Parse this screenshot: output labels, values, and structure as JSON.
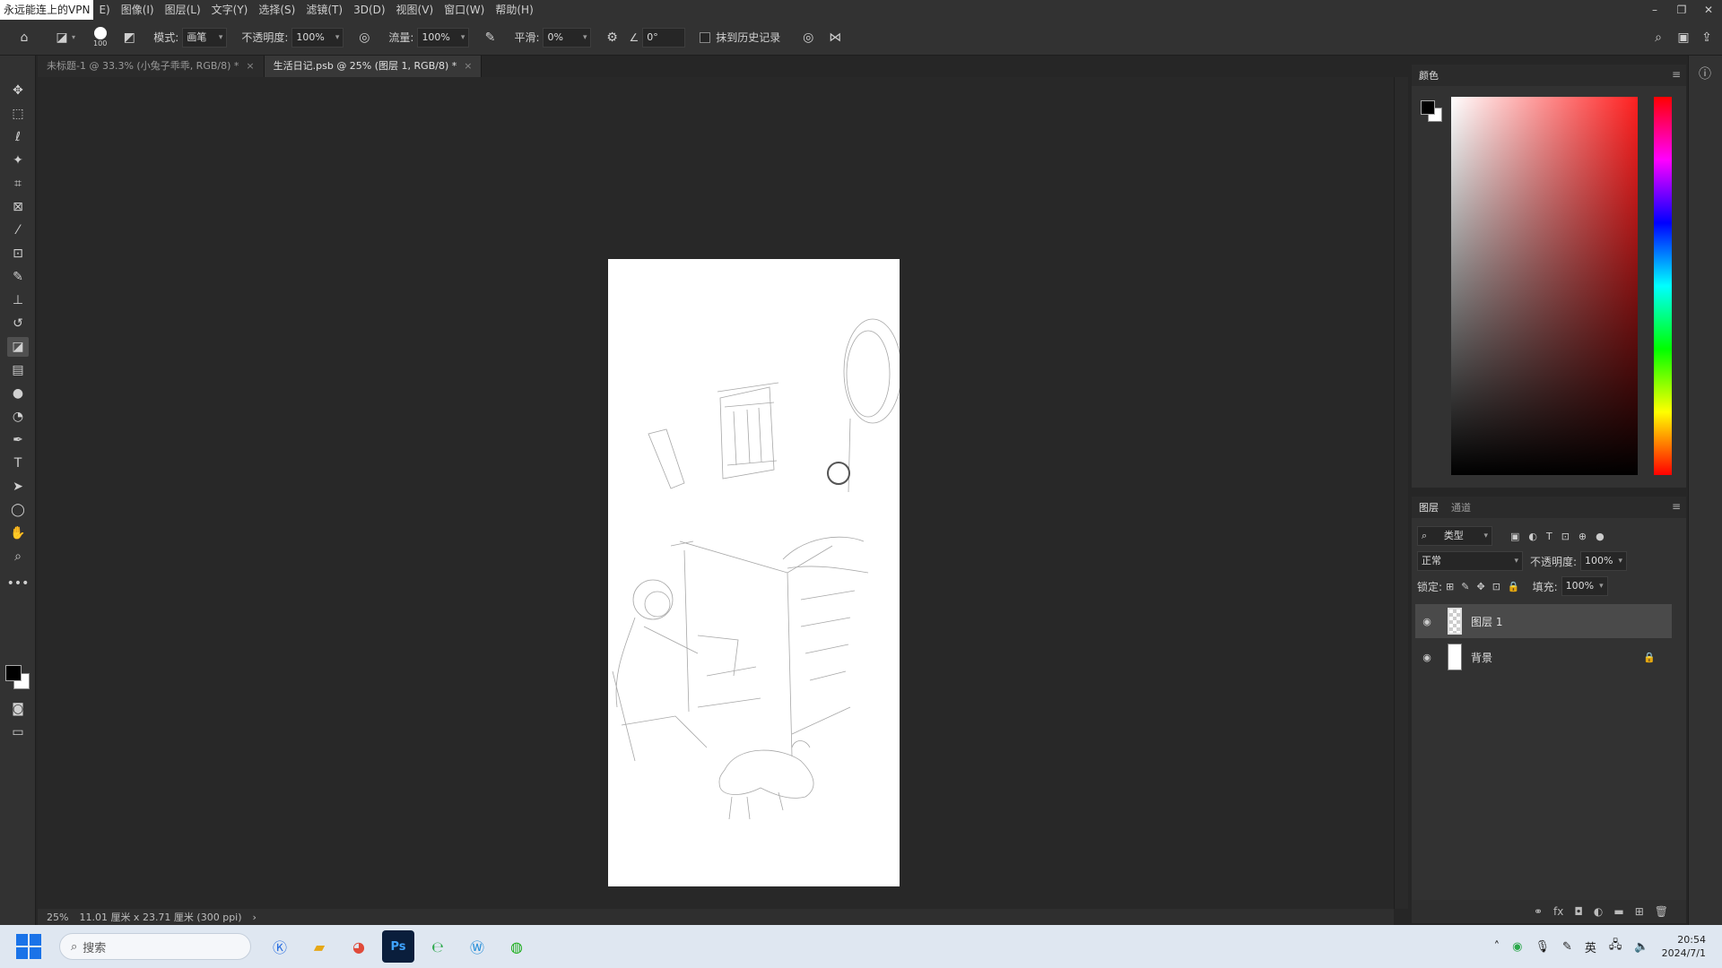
{
  "menubar": {
    "vpn_label": "永远能连上的VPN",
    "items": [
      "E)",
      "图像(I)",
      "图层(L)",
      "文字(Y)",
      "选择(S)",
      "滤镜(T)",
      "3D(D)",
      "视图(V)",
      "窗口(W)",
      "帮助(H)"
    ]
  },
  "options": {
    "brush_size": "100",
    "mode_label": "模式:",
    "mode_value": "画笔",
    "opacity_label": "不透明度:",
    "opacity_value": "100%",
    "flow_label": "流量:",
    "flow_value": "100%",
    "smooth_label": "平滑:",
    "smooth_value": "0%",
    "angle_value": "0°",
    "erase_history_label": "抹到历史记录"
  },
  "tabs": [
    {
      "label": "未标题-1 @ 33.3% (小兔子乖乖, RGB/8) *",
      "active": false
    },
    {
      "label": "生活日记.psb @ 25% (图层 1, RGB/8) *",
      "active": true
    }
  ],
  "statusbar": {
    "zoom": "25%",
    "doc_info": "11.01 厘米 x 23.71 厘米 (300 ppi)"
  },
  "color_panel": {
    "title": "颜色"
  },
  "layers_panel": {
    "tab_layers": "图层",
    "tab_channels": "通道",
    "filter_value": "类型",
    "blend_mode": "正常",
    "opacity_label": "不透明度:",
    "opacity_value": "100%",
    "lock_label": "锁定:",
    "fill_label": "填充:",
    "fill_value": "100%",
    "layers": [
      {
        "name": "图层 1",
        "selected": true
      },
      {
        "name": "背景",
        "selected": false,
        "locked": true
      }
    ]
  },
  "taskbar": {
    "search_placeholder": "搜索",
    "tray_ime": "英",
    "time": "20:54",
    "date": "2024/7/1"
  }
}
